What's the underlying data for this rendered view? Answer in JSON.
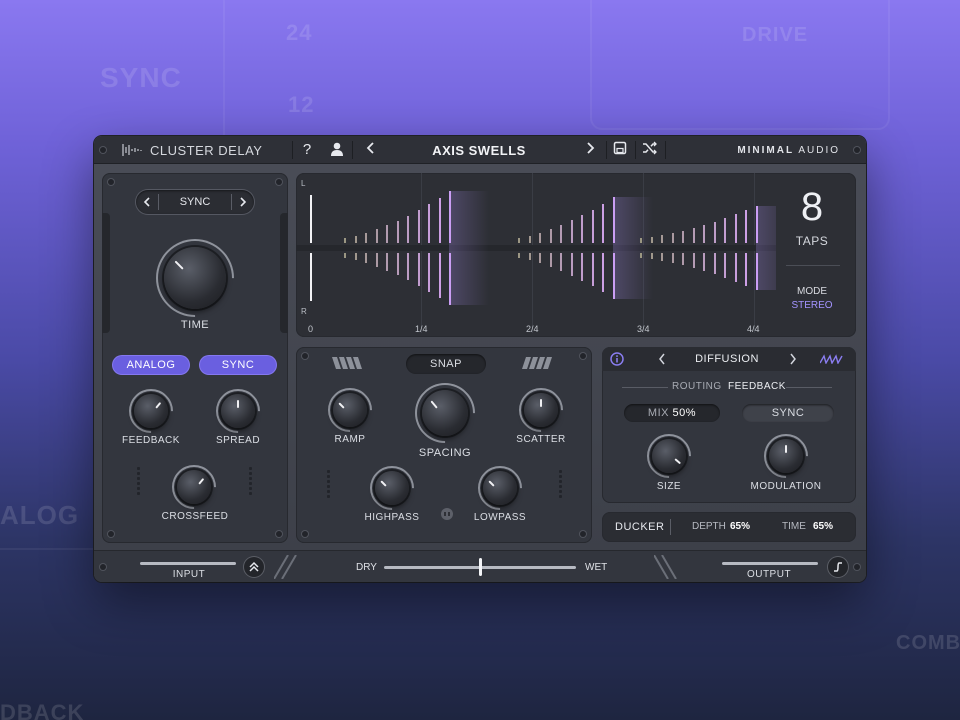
{
  "background_hints": [
    "SYNC",
    "DRIVE",
    "ALOG",
    "DBACK",
    "COMB",
    "24",
    "12"
  ],
  "header": {
    "title": "CLUSTER DELAY",
    "help_label": "?",
    "preset_name": "AXIS SWELLS",
    "brand_bold": "MINIMAL",
    "brand_light": "AUDIO"
  },
  "time_section": {
    "sync_selector": "SYNC",
    "time_label": "TIME",
    "analog_button": "ANALOG",
    "sync_button": "SYNC",
    "feedback_label": "FEEDBACK",
    "spread_label": "SPREAD",
    "crossfeed_label": "CROSSFEED"
  },
  "display": {
    "channel_left": "L",
    "channel_right": "R",
    "ticks": [
      "0",
      "1/4",
      "2/4",
      "3/4",
      "4/4"
    ],
    "taps_count": "8",
    "taps_label": "TAPS",
    "mode_label": "MODE",
    "mode_value": "STEREO"
  },
  "spacing_section": {
    "snap_button": "SNAP",
    "ramp_label": "RAMP",
    "spacing_label": "SPACING",
    "scatter_label": "SCATTER",
    "highpass_label": "HIGHPASS",
    "lowpass_label": "LOWPASS"
  },
  "diffusion_section": {
    "title": "DIFFUSION",
    "routing_label": "ROUTING",
    "routing_value": "FEEDBACK",
    "mix_label": "MIX",
    "mix_value": "50%",
    "sync_button": "SYNC",
    "size_label": "SIZE",
    "modulation_label": "MODULATION"
  },
  "ducker": {
    "label": "DUCKER",
    "depth_label": "DEPTH",
    "depth_value": "65%",
    "time_label": "TIME",
    "time_value": "65%"
  },
  "footer": {
    "input_label": "INPUT",
    "dry_label": "DRY",
    "wet_label": "WET",
    "output_label": "OUTPUT",
    "drywet_level": 0.5
  },
  "colors": {
    "accent": "#6a5fe0",
    "accent_light": "#a78bfa",
    "panel": "#33363e",
    "header": "#2e3037"
  }
}
